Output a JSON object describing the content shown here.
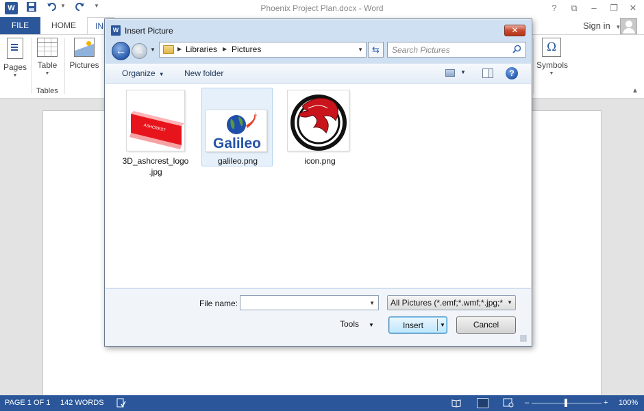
{
  "window": {
    "title": "Phoenix Project Plan.docx - Word",
    "app_logo": "W",
    "controls": [
      "?",
      "⧉",
      "–",
      "❐",
      "✕"
    ]
  },
  "quick_access": {
    "save_icon": "save-icon",
    "undo_icon": "undo-icon",
    "redo_icon": "redo-icon",
    "customize_icon": "customize-icon"
  },
  "ribbon": {
    "tabs": {
      "file": "FILE",
      "home": "HOME",
      "insert": "INSERT"
    },
    "signin": "Sign in",
    "items": {
      "pages": "Pages",
      "table": "Table",
      "pictures": "Pictures",
      "symbols": "Symbols"
    },
    "groups": {
      "tables": "Tables"
    }
  },
  "dialog": {
    "title": "Insert Picture",
    "breadcrumb": [
      "Libraries",
      "Pictures"
    ],
    "search_placeholder": "Search Pictures",
    "toolbar": {
      "organize": "Organize",
      "new_folder": "New folder"
    },
    "files": [
      {
        "name_line1": "3D_ashcrest_logo",
        "name_line2": ".jpg",
        "thumb_text": "ASHCREST"
      },
      {
        "name_line1": "galileo.png",
        "name_line2": "",
        "thumb_text": "Galileo"
      },
      {
        "name_line1": "icon.png",
        "name_line2": "",
        "thumb_text": ""
      }
    ],
    "file_name_label": "File name:",
    "file_name_value": "",
    "filter": "All Pictures (*.emf;*.wmf;*.jpg;*",
    "tools": "Tools",
    "insert": "Insert",
    "cancel": "Cancel"
  },
  "status": {
    "page": "PAGE 1 OF 1",
    "words": "142 WORDS",
    "zoom": "100%",
    "zoom_level_percent": 100
  }
}
